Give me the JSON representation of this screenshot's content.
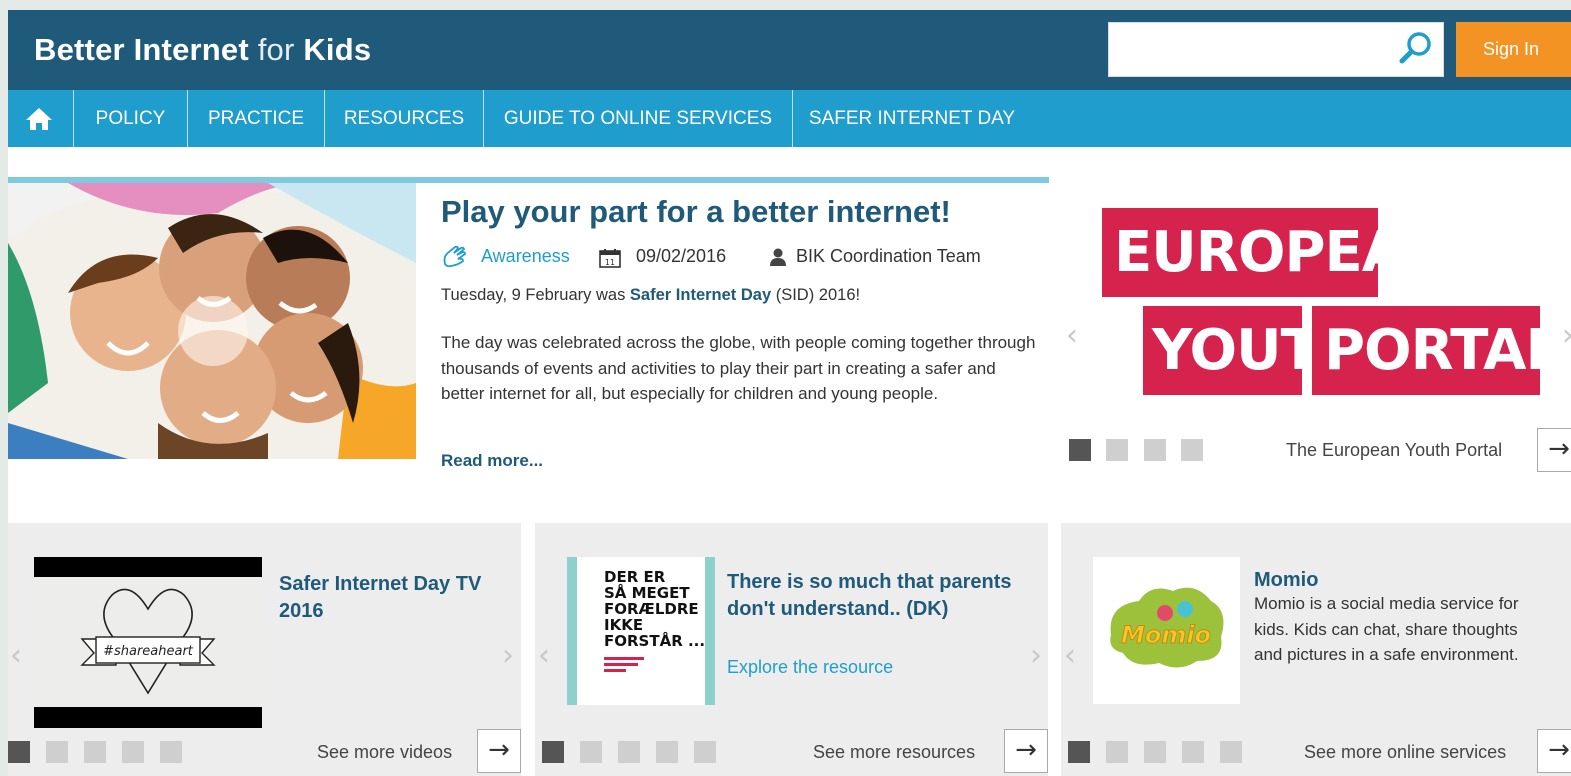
{
  "header": {
    "logo_better": "Better",
    "logo_internet": "Internet",
    "logo_for": "for",
    "logo_kids": "Kids",
    "search_placeholder": "",
    "signin_label": "Sign In"
  },
  "nav": {
    "items": [
      "POLICY",
      "PRACTICE",
      "RESOURCES",
      "GUIDE TO ONLINE SERVICES",
      "SAFER INTERNET DAY"
    ]
  },
  "featured": {
    "title": "Play your part for a better internet!",
    "tag": "Awareness",
    "date": "09/02/2016",
    "author": "BIK Coordination Team",
    "intro_prefix": "Tuesday, 9 February was ",
    "intro_bold": "Safer Internet Day",
    "intro_suffix": " (SID) 2016!",
    "body": "The day was celebrated across the globe, with people coming together through thousands of events and activities to play their part in creating a safer and better internet for all, but especially for children and young people.",
    "read_more": "Read more..."
  },
  "spotlight": {
    "banner_line1": "EUROPEAN",
    "banner_word1": "YOUTH",
    "banner_word2": "PORTAL",
    "caption": "The European Youth Portal"
  },
  "cards": {
    "videos": {
      "title": "Safer Internet Day TV 2016",
      "thumb_text": "#shareaheart",
      "more_label": "See more videos"
    },
    "resources": {
      "title": "There is so much that parents don't understand.. (DK)",
      "link": "Explore the resource",
      "thumb_lines": [
        "DER ER",
        "SÅ MEGET",
        "FORÆLDRE",
        "IKKE",
        "FORSTÅR ..."
      ],
      "more_label": "See more resources"
    },
    "services": {
      "title": "Momio",
      "desc": "Momio is a social media service for kids. Kids can chat, share thoughts and pictures in a safe environment.",
      "thumb_text": "Momio",
      "more_label": "See more online services"
    }
  },
  "colors": {
    "header_dark": "#1f5a7a",
    "nav_blue": "#1f9ece",
    "signin_orange": "#f39323",
    "banner_red": "#d6234d"
  }
}
